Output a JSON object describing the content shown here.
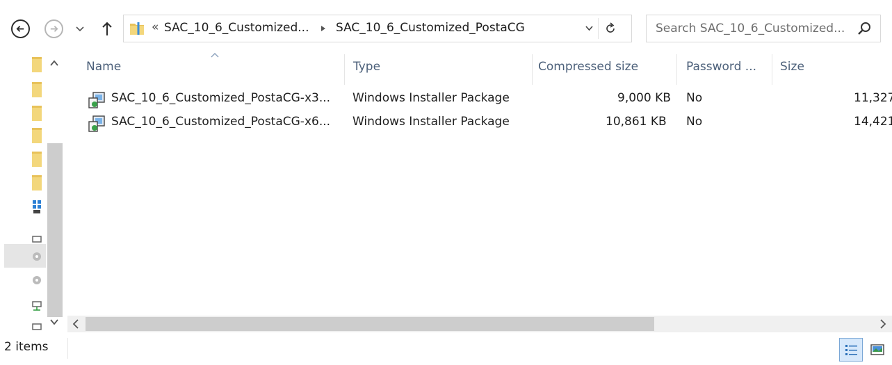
{
  "toolbar": {
    "back_icon": "back-arrow-icon",
    "forward_icon": "forward-arrow-icon",
    "recent_icon": "chevron-down-icon",
    "up_icon": "up-arrow-icon"
  },
  "address": {
    "overflow_chevron": "«",
    "crumb1": "SAC_10_6_Customized...",
    "crumb2": "SAC_10_6_Customized_PostaCG"
  },
  "search": {
    "placeholder": "Search SAC_10_6_Customized..."
  },
  "columns": {
    "name": "Name",
    "type": "Type",
    "compressed_size": "Compressed size",
    "password": "Password ...",
    "size": "Size"
  },
  "files": [
    {
      "name": "SAC_10_6_Customized_PostaCG-x3...",
      "type": "Windows Installer Package",
      "compressed_size": "9,000 KB",
      "password": "No",
      "size": "11,327"
    },
    {
      "name": "SAC_10_6_Customized_PostaCG-x6...",
      "type": "Windows Installer Package",
      "compressed_size": "10,861 KB",
      "password": "No",
      "size": "14,421"
    }
  ],
  "status": {
    "item_count": "2 items"
  },
  "colors": {
    "header_text": "#4c607a",
    "folder_yellow": "#e8c25a",
    "selected_view": "#d6e8fb"
  }
}
